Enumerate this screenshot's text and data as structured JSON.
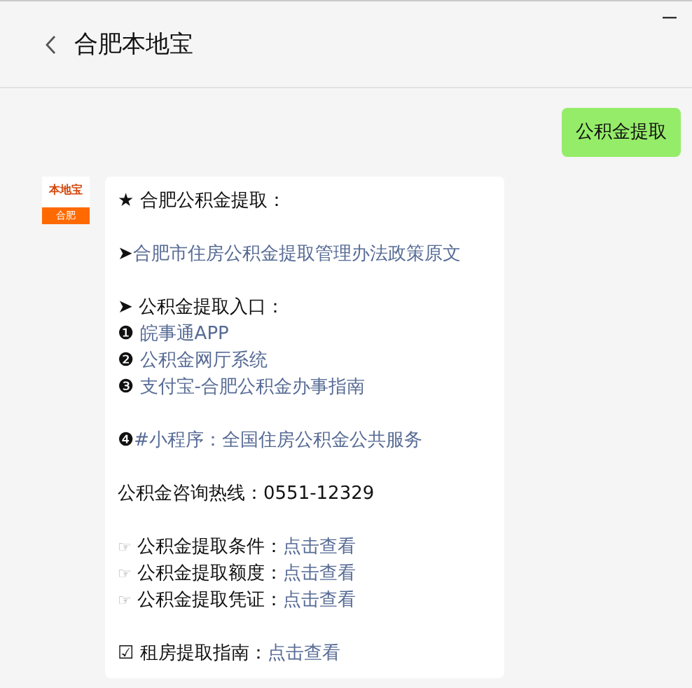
{
  "window": {
    "title": "合肥本地宝"
  },
  "messages": [
    {
      "outgoing": true,
      "kind": "text",
      "text": "公积金提取"
    },
    {
      "outgoing": false,
      "kind": "rich",
      "avatar": {
        "top": "本地宝",
        "bottom": "合肥"
      },
      "paragraphs": [
        [
          [
            {
              "kind": "text",
              "text": "★ 合肥公积金提取："
            }
          ]
        ],
        [
          [
            {
              "kind": "text",
              "text": "➤"
            },
            {
              "kind": "link",
              "text": "合肥市住房公积金提取管理办法政策原文"
            }
          ]
        ],
        [
          [
            {
              "kind": "text",
              "text": "➤ 公积金提取入口："
            }
          ],
          [
            {
              "kind": "text",
              "text": "❶ "
            },
            {
              "kind": "link",
              "text": "皖事通APP"
            }
          ],
          [
            {
              "kind": "text",
              "text": "❷ "
            },
            {
              "kind": "link",
              "text": "公积金网厅系统"
            }
          ],
          [
            {
              "kind": "text",
              "text": "❸ "
            },
            {
              "kind": "link",
              "text": "支付宝-合肥公积金办事指南"
            }
          ]
        ],
        [
          [
            {
              "kind": "text",
              "text": "❹"
            },
            {
              "kind": "link",
              "text": "#小程序：全国住房公积金公共服务"
            }
          ]
        ],
        [
          [
            {
              "kind": "text",
              "text": "公积金咨询热线：0551-12329"
            }
          ]
        ],
        [
          [
            {
              "kind": "icon",
              "text": "☞"
            },
            {
              "kind": "text",
              "text": " 公积金提取条件："
            },
            {
              "kind": "link",
              "text": "点击查看"
            }
          ],
          [
            {
              "kind": "icon",
              "text": "☞"
            },
            {
              "kind": "text",
              "text": " 公积金提取额度："
            },
            {
              "kind": "link",
              "text": "点击查看"
            }
          ],
          [
            {
              "kind": "icon",
              "text": "☞"
            },
            {
              "kind": "text",
              "text": " 公积金提取凭证："
            },
            {
              "kind": "link",
              "text": "点击查看"
            }
          ]
        ],
        [
          [
            {
              "kind": "text",
              "text": "☑ 租房提取指南："
            },
            {
              "kind": "link",
              "text": "点击查看"
            }
          ]
        ]
      ]
    }
  ]
}
